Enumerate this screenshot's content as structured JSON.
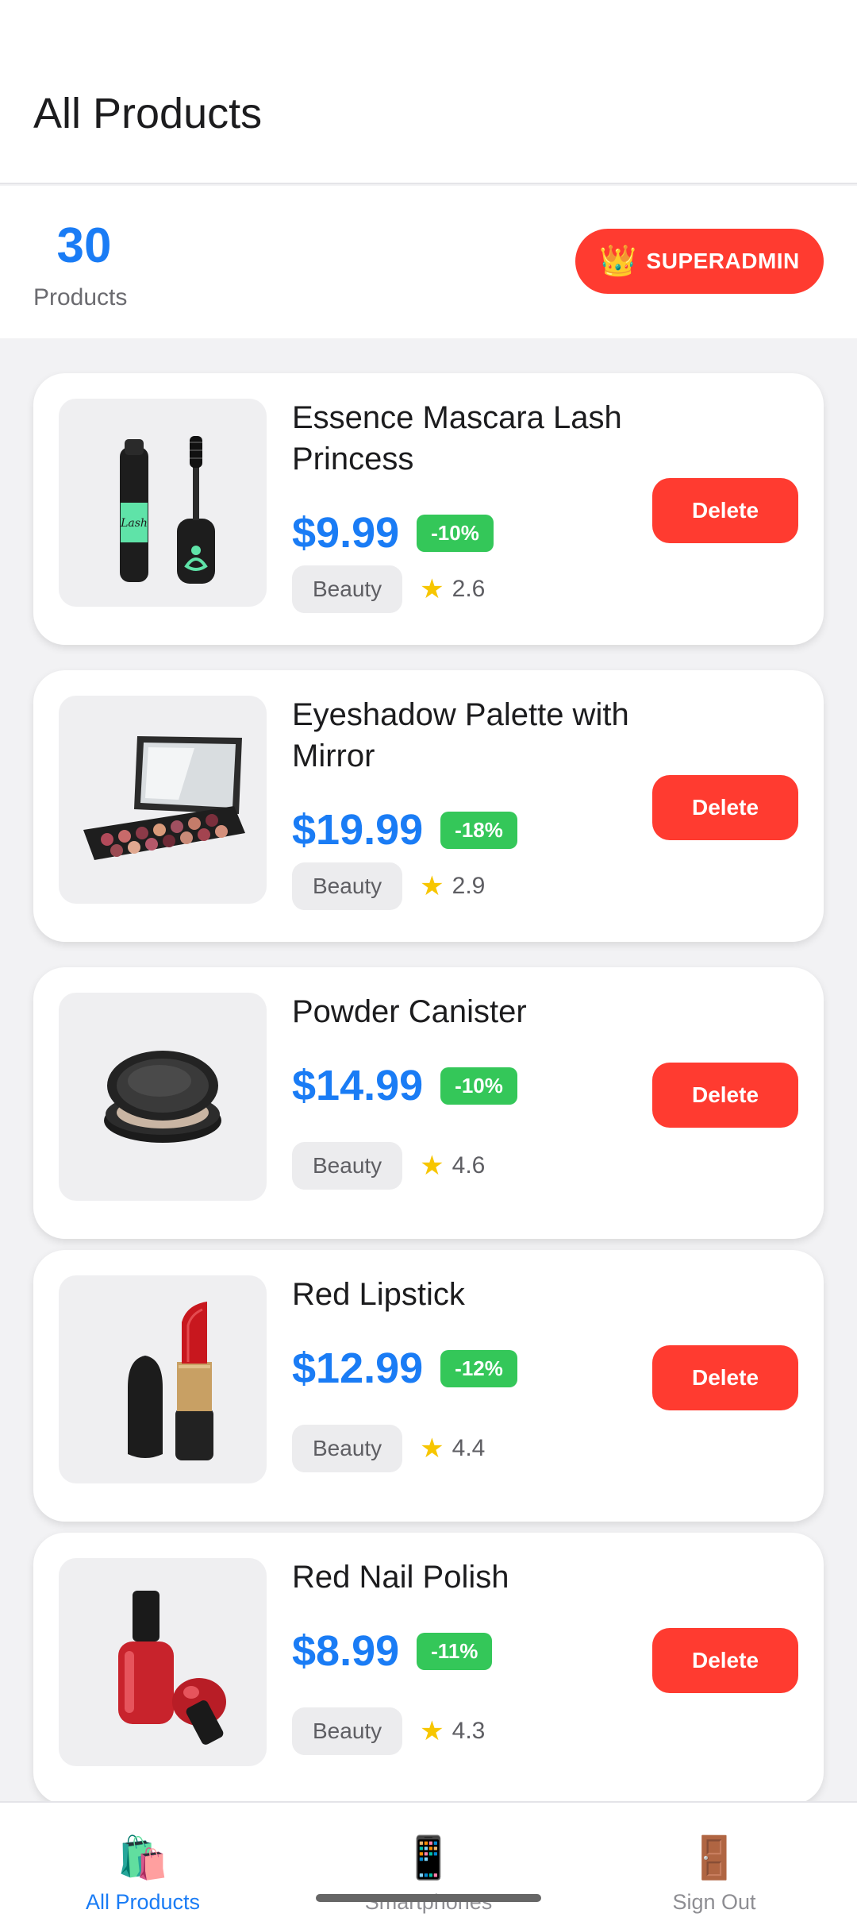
{
  "header": {
    "title": "All Products"
  },
  "stats": {
    "count": "30",
    "label": "Products",
    "role_icon": "👑",
    "role": "SUPERADMIN"
  },
  "products": [
    {
      "title_line1": "Essence Mascara Lash",
      "title_line2": "Princess",
      "price": "$9.99",
      "discount": "-10%",
      "category": "Beauty",
      "rating": "2.6",
      "image": "mascara-image",
      "delete_label": "Delete"
    },
    {
      "title_line1": "Eyeshadow Palette with",
      "title_line2": "Mirror",
      "price": "$19.99",
      "discount": "-18%",
      "category": "Beauty",
      "rating": "2.9",
      "image": "eyeshadow-palette-image",
      "delete_label": "Delete"
    },
    {
      "title_line1": "Powder Canister",
      "title_line2": "",
      "price": "$14.99",
      "discount": "-10%",
      "category": "Beauty",
      "rating": "4.6",
      "image": "powder-canister-image",
      "delete_label": "Delete"
    },
    {
      "title_line1": "Red Lipstick",
      "title_line2": "",
      "price": "$12.99",
      "discount": "-12%",
      "category": "Beauty",
      "rating": "4.4",
      "image": "lipstick-image",
      "delete_label": "Delete"
    },
    {
      "title_line1": "Red Nail Polish",
      "title_line2": "",
      "price": "$8.99",
      "discount": "-11%",
      "category": "Beauty",
      "rating": "4.3",
      "image": "nail-polish-image",
      "delete_label": "Delete"
    }
  ],
  "nav": {
    "items": [
      {
        "icon": "🛍️",
        "label": "All Products",
        "active": true
      },
      {
        "icon": "📱",
        "label": "Smartphones",
        "active": false
      },
      {
        "icon": "🚪",
        "label": "Sign Out",
        "active": false
      }
    ]
  },
  "colors": {
    "accent": "#1a7cf5",
    "danger": "#ff3b30",
    "success": "#34c759",
    "star": "#f7c600"
  }
}
